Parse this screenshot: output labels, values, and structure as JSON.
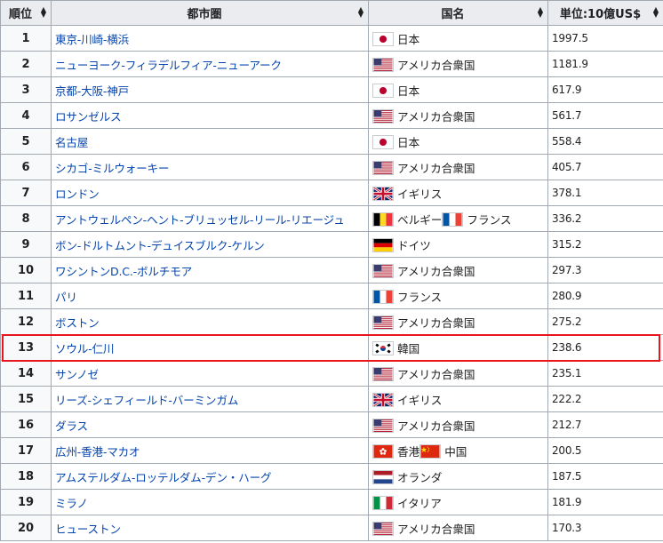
{
  "headers": {
    "rank": "順位",
    "city": "都市圏",
    "country": "国名",
    "value": "単位:10億US$"
  },
  "rows": [
    {
      "rank": "1",
      "city": "東京-川崎-横浜",
      "countries": [
        {
          "flag": "jp",
          "name": "日本"
        }
      ],
      "value": "1997.5"
    },
    {
      "rank": "2",
      "city": "ニューヨーク-フィラデルフィア-ニューアーク",
      "countries": [
        {
          "flag": "us",
          "name": "アメリカ合衆国"
        }
      ],
      "value": "1181.9"
    },
    {
      "rank": "3",
      "city": "京都-大阪-神戸",
      "countries": [
        {
          "flag": "jp",
          "name": "日本"
        }
      ],
      "value": "617.9"
    },
    {
      "rank": "4",
      "city": "ロサンゼルス",
      "countries": [
        {
          "flag": "us",
          "name": "アメリカ合衆国"
        }
      ],
      "value": "561.7"
    },
    {
      "rank": "5",
      "city": "名古屋",
      "countries": [
        {
          "flag": "jp",
          "name": "日本"
        }
      ],
      "value": "558.4"
    },
    {
      "rank": "6",
      "city": "シカゴ-ミルウォーキー",
      "countries": [
        {
          "flag": "us",
          "name": "アメリカ合衆国"
        }
      ],
      "value": "405.7"
    },
    {
      "rank": "7",
      "city": "ロンドン",
      "countries": [
        {
          "flag": "gb",
          "name": "イギリス"
        }
      ],
      "value": "378.1"
    },
    {
      "rank": "8",
      "city": "アントウェルペン-ヘント-ブリュッセル-リール-リエージュ",
      "countries": [
        {
          "flag": "be",
          "name": "ベルギー"
        },
        {
          "flag": "fr",
          "name": "フランス"
        }
      ],
      "value": "336.2"
    },
    {
      "rank": "9",
      "city": "ボン-ドルトムント-デュイスブルク-ケルン",
      "countries": [
        {
          "flag": "de",
          "name": "ドイツ"
        }
      ],
      "value": "315.2"
    },
    {
      "rank": "10",
      "city": "ワシントンD.C.-ボルチモア",
      "countries": [
        {
          "flag": "us",
          "name": "アメリカ合衆国"
        }
      ],
      "value": "297.3"
    },
    {
      "rank": "11",
      "city": "パリ",
      "countries": [
        {
          "flag": "fr",
          "name": "フランス"
        }
      ],
      "value": "280.9"
    },
    {
      "rank": "12",
      "city": "ボストン",
      "countries": [
        {
          "flag": "us",
          "name": "アメリカ合衆国"
        }
      ],
      "value": "275.2"
    },
    {
      "rank": "13",
      "city": "ソウル-仁川",
      "countries": [
        {
          "flag": "kr",
          "name": "韓国"
        }
      ],
      "value": "238.6",
      "highlight": true
    },
    {
      "rank": "14",
      "city": "サンノゼ",
      "countries": [
        {
          "flag": "us",
          "name": "アメリカ合衆国"
        }
      ],
      "value": "235.1"
    },
    {
      "rank": "15",
      "city": "リーズ-シェフィールド-バーミンガム",
      "countries": [
        {
          "flag": "gb",
          "name": "イギリス"
        }
      ],
      "value": "222.2"
    },
    {
      "rank": "16",
      "city": "ダラス",
      "countries": [
        {
          "flag": "us",
          "name": "アメリカ合衆国"
        }
      ],
      "value": "212.7"
    },
    {
      "rank": "17",
      "city": "広州-香港-マカオ",
      "countries": [
        {
          "flag": "hk",
          "name": "香港"
        },
        {
          "flag": "cn",
          "name": "中国"
        }
      ],
      "value": "200.5"
    },
    {
      "rank": "18",
      "city": "アムステルダム-ロッテルダム-デン・ハーグ",
      "countries": [
        {
          "flag": "nl",
          "name": "オランダ"
        }
      ],
      "value": "187.5"
    },
    {
      "rank": "19",
      "city": "ミラノ",
      "countries": [
        {
          "flag": "it",
          "name": "イタリア"
        }
      ],
      "value": "181.9"
    },
    {
      "rank": "20",
      "city": "ヒューストン",
      "countries": [
        {
          "flag": "us",
          "name": "アメリカ合衆国"
        }
      ],
      "value": "170.3"
    }
  ],
  "colors": {
    "link": "#0645ad",
    "header_bg": "#eaecf0",
    "border": "#a2a9b1",
    "highlight": "#e8161c"
  }
}
